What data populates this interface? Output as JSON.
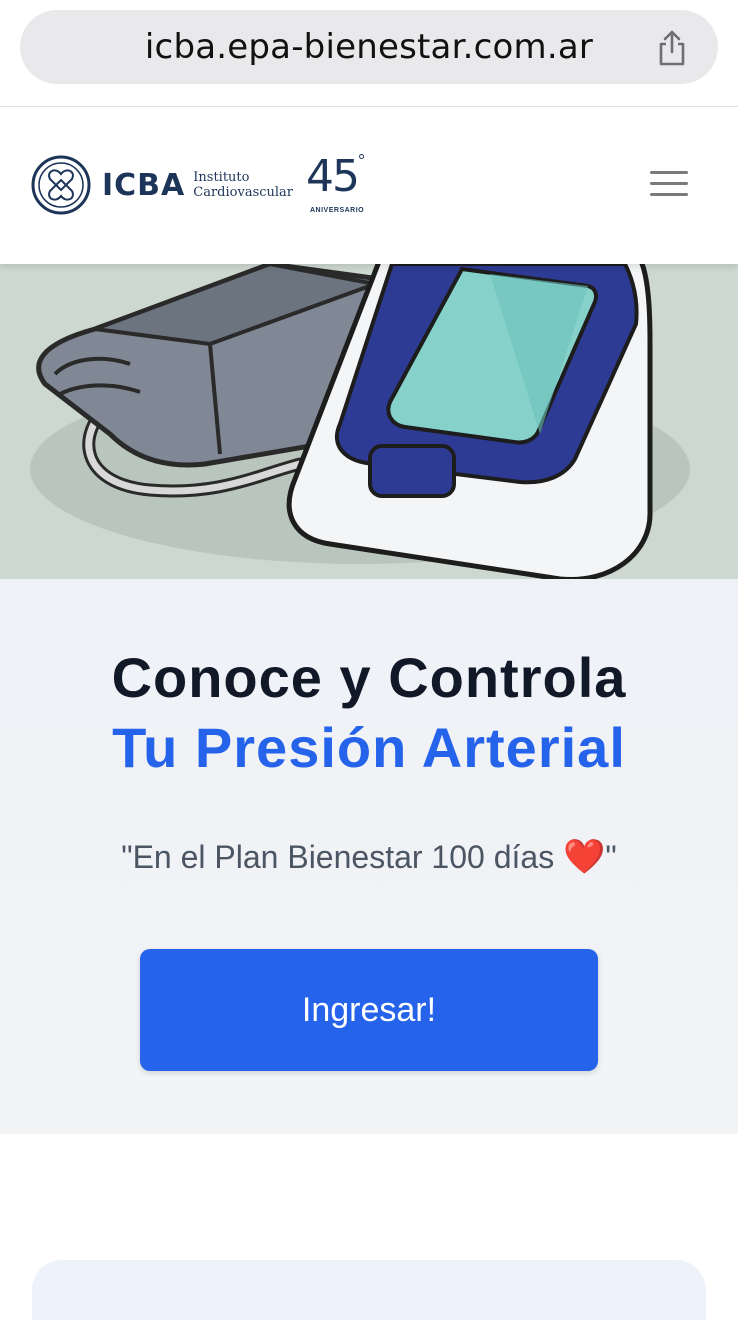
{
  "browser": {
    "url": "icba.epa-bienestar.com.ar",
    "share_icon": "share-icon"
  },
  "header": {
    "logo_text": "ICBA",
    "logo_sub_line1": "Instituto",
    "logo_sub_line2": "Cardiovascular",
    "anniversary_number": "45",
    "anniversary_degree": "°",
    "anniversary_label": "ANIVERSARIO",
    "menu_icon": "hamburger-menu-icon"
  },
  "hero": {
    "illustration": "blood-pressure-monitor-illustration"
  },
  "main": {
    "title_line1": "Conoce y Controla",
    "title_line2": "Tu Presión Arterial",
    "subtitle_text": "\"En el Plan Bienestar 100 días ",
    "subtitle_emoji": "❤️",
    "subtitle_end": "\"",
    "cta_label": "Ingresar!"
  },
  "colors": {
    "primary": "#2563eb",
    "heading": "#111827",
    "brand_navy": "#1c3559"
  }
}
